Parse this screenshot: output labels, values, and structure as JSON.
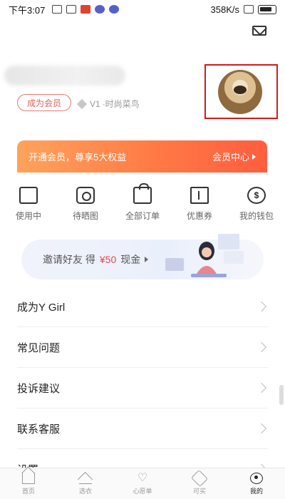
{
  "status_bar": {
    "time": "下午3:07",
    "net_speed": "358K/s"
  },
  "profile": {
    "member_button": "成为会员",
    "level_badge": "V1",
    "level_name": "·时尚菜鸟"
  },
  "member_banner": {
    "promo": "开通会员，尊享5大权益",
    "center_link": "会员中心"
  },
  "quick_actions": [
    {
      "label": "使用中",
      "icon": "wallet-icon"
    },
    {
      "label": "待晒图",
      "icon": "camera-icon"
    },
    {
      "label": "全部订单",
      "icon": "bag-icon"
    },
    {
      "label": "优惠券",
      "icon": "ticket-icon"
    },
    {
      "label": "我的钱包",
      "icon": "coin-icon"
    }
  ],
  "invite": {
    "text": "邀请好友 得",
    "amount": "¥50",
    "suffix": "现金"
  },
  "menu_items": [
    {
      "label": "成为Y Girl"
    },
    {
      "label": "常见问题"
    },
    {
      "label": "投诉建议"
    },
    {
      "label": "联系客服"
    },
    {
      "label": "设置"
    }
  ],
  "bottom_nav": [
    {
      "label": "首页",
      "icon": "home-icon"
    },
    {
      "label": "选衣",
      "icon": "hanger-icon"
    },
    {
      "label": "心愿单",
      "icon": "heart-icon"
    },
    {
      "label": "可买",
      "icon": "tag-icon"
    },
    {
      "label": "我的",
      "icon": "user-icon"
    }
  ],
  "colors": {
    "accent": "#ff6a44",
    "member_red": "#e0605a",
    "price_red": "#e24b4b",
    "highlight_frame": "#d01c1c"
  }
}
